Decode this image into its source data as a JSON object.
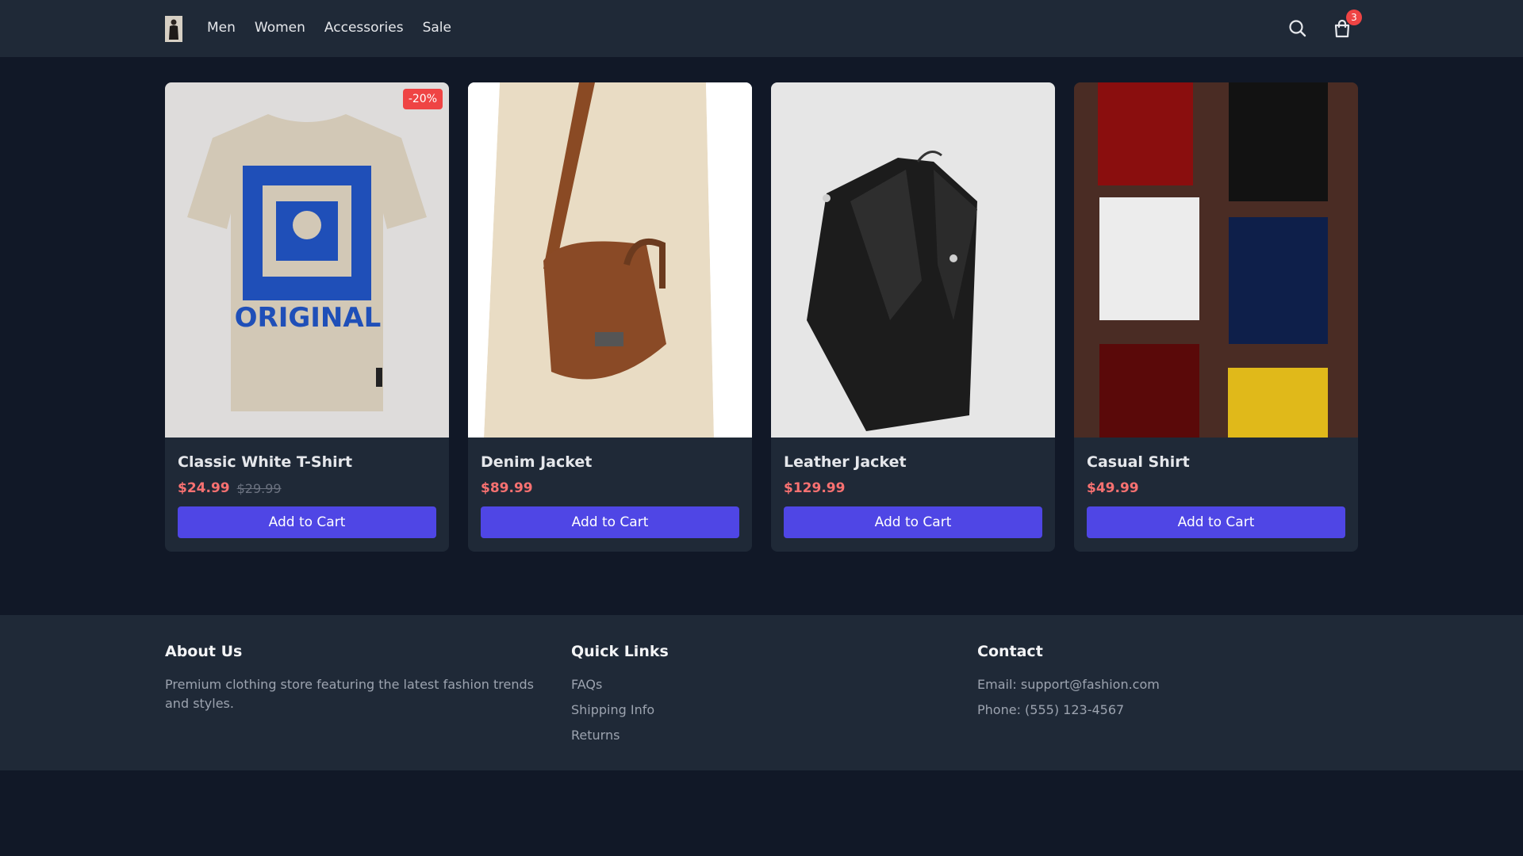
{
  "header": {
    "nav": [
      "Men",
      "Women",
      "Accessories",
      "Sale"
    ],
    "cart_count": "3",
    "icons": {
      "search": "search-icon",
      "cart": "shopping-bag-icon",
      "logo": "logo-person-image"
    }
  },
  "products": [
    {
      "title": "Classic White T-Shirt",
      "price": "$24.99",
      "old_price": "$29.99",
      "badge": "-20%",
      "button": "Add to Cart"
    },
    {
      "title": "Denim Jacket",
      "price": "$89.99",
      "old_price": "",
      "badge": "",
      "button": "Add to Cart"
    },
    {
      "title": "Leather Jacket",
      "price": "$129.99",
      "old_price": "",
      "badge": "",
      "button": "Add to Cart"
    },
    {
      "title": "Casual Shirt",
      "price": "$49.99",
      "old_price": "",
      "badge": "",
      "button": "Add to Cart"
    }
  ],
  "footer": {
    "about": {
      "title": "About Us",
      "text": "Premium clothing store featuring the latest fashion trends and styles."
    },
    "links": {
      "title": "Quick Links",
      "items": [
        "FAQs",
        "Shipping Info",
        "Returns"
      ]
    },
    "contact": {
      "title": "Contact",
      "email": "Email: support@fashion.com",
      "phone": "Phone: (555) 123-4567"
    }
  },
  "colors": {
    "background": "#111827",
    "surface": "#1f2937",
    "accent": "#4f46e5",
    "price": "#f87171",
    "badge": "#ef4444"
  }
}
